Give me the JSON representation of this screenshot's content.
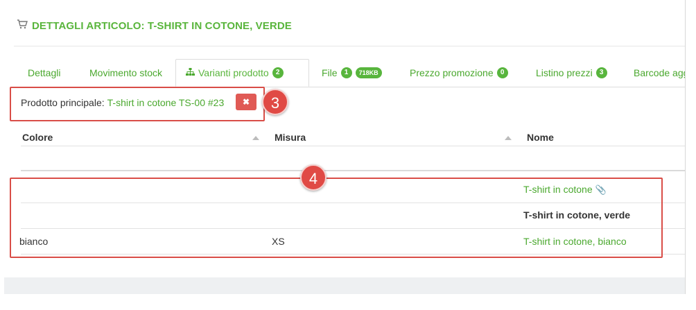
{
  "header": {
    "cart_icon": "cart-icon",
    "title": "DETTAGLI ARTICOLO: T-SHIRT IN COTONE, VERDE"
  },
  "tabs": [
    {
      "label": "Dettagli"
    },
    {
      "label": "Movimento stock"
    },
    {
      "label": "Varianti prodotto",
      "badge": "2",
      "icon": "sitemap-icon",
      "active": true
    },
    {
      "label": "File",
      "badge": "1",
      "badge2": "718KB"
    },
    {
      "label": "Prezzo promozione",
      "badge": "0"
    },
    {
      "label": "Listino prezzi",
      "badge": "3"
    },
    {
      "label": "Barcode agg"
    }
  ],
  "parent": {
    "label": "Prodotto principale:",
    "link": "T-shirt in cotone TS-00 #23",
    "remove_icon": "close-icon"
  },
  "callouts": {
    "first": "3",
    "second": "4"
  },
  "table": {
    "columns": [
      "Colore",
      "Misura",
      "Nome"
    ],
    "rows": [
      {
        "colore": "",
        "misura": "",
        "nome": "T-shirt in cotone",
        "nome_style": "link",
        "icon": "paperclip-icon"
      },
      {
        "colore": "",
        "misura": "",
        "nome": "T-shirt in cotone, verde",
        "nome_style": "bold"
      },
      {
        "colore": "bianco",
        "misura": "XS",
        "nome": "T-shirt in cotone, bianco",
        "nome_style": "link"
      }
    ]
  },
  "colors": {
    "accent": "#59b53c",
    "callout": "#e04a45"
  }
}
